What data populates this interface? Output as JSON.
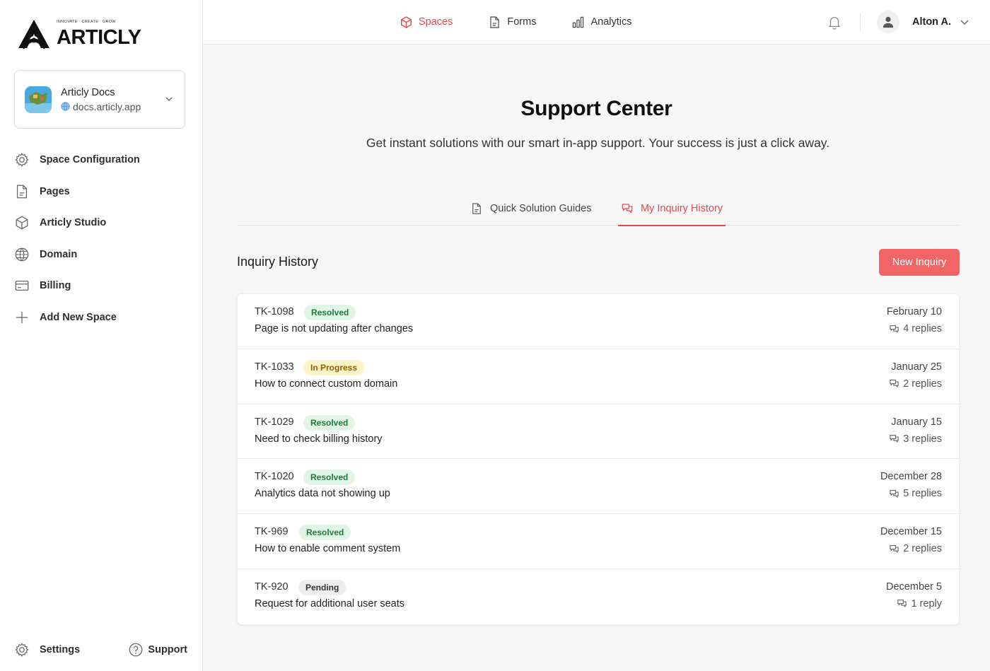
{
  "brand": {
    "name": "ARTICLY",
    "tagline": "INNOVATE · CREATE · GROW"
  },
  "space": {
    "name": "Articly Docs",
    "domain": "docs.articly.app"
  },
  "sidebar": {
    "items": [
      {
        "label": "Space Configuration",
        "icon": "gear-icon"
      },
      {
        "label": "Pages",
        "icon": "document-icon"
      },
      {
        "label": "Articly Studio",
        "icon": "cube-icon"
      },
      {
        "label": "Domain",
        "icon": "globe-icon"
      },
      {
        "label": "Billing",
        "icon": "credit-card-icon"
      },
      {
        "label": "Add New Space",
        "icon": "plus-icon"
      }
    ],
    "footer": {
      "settings_label": "Settings",
      "support_label": "Support"
    }
  },
  "topnav": {
    "items": [
      {
        "label": "Spaces",
        "icon": "cube-icon",
        "active": true
      },
      {
        "label": "Forms",
        "icon": "document-icon",
        "active": false
      },
      {
        "label": "Analytics",
        "icon": "bar-chart-icon",
        "active": false
      }
    ],
    "user_name": "Alton A."
  },
  "page": {
    "title": "Support Center",
    "subtitle": "Get instant solutions with our smart in-app support. Your success is just a click away."
  },
  "tabs": [
    {
      "label": "Quick Solution Guides",
      "icon": "document-icon",
      "active": false
    },
    {
      "label": "My Inquiry History",
      "icon": "chat-bubbles-icon",
      "active": true
    }
  ],
  "history": {
    "title": "Inquiry History",
    "new_button": "New Inquiry",
    "rows": [
      {
        "id": "TK-1098",
        "status": "Resolved",
        "subject": "Page is not updating after changes",
        "date": "February 10",
        "replies": "4 replies"
      },
      {
        "id": "TK-1033",
        "status": "In Progress",
        "subject": "How to connect custom domain",
        "date": "January 25",
        "replies": "2 replies"
      },
      {
        "id": "TK-1029",
        "status": "Resolved",
        "subject": "Need to check billing history",
        "date": "January 15",
        "replies": "3 replies"
      },
      {
        "id": "TK-1020",
        "status": "Resolved",
        "subject": "Analytics data not showing up",
        "date": "December 28",
        "replies": "5 replies"
      },
      {
        "id": "TK-969",
        "status": "Resolved",
        "subject": "How to enable comment system",
        "date": "December 15",
        "replies": "2 replies"
      },
      {
        "id": "TK-920",
        "status": "Pending",
        "subject": "Request for additional user seats",
        "date": "December 5",
        "replies": "1 reply"
      }
    ]
  },
  "colors": {
    "accent": "#e5484d",
    "button": "#f26566",
    "resolved_bg": "#e1f5e6",
    "progress_bg": "#fdf3c8",
    "pending_bg": "#eeeeee"
  }
}
